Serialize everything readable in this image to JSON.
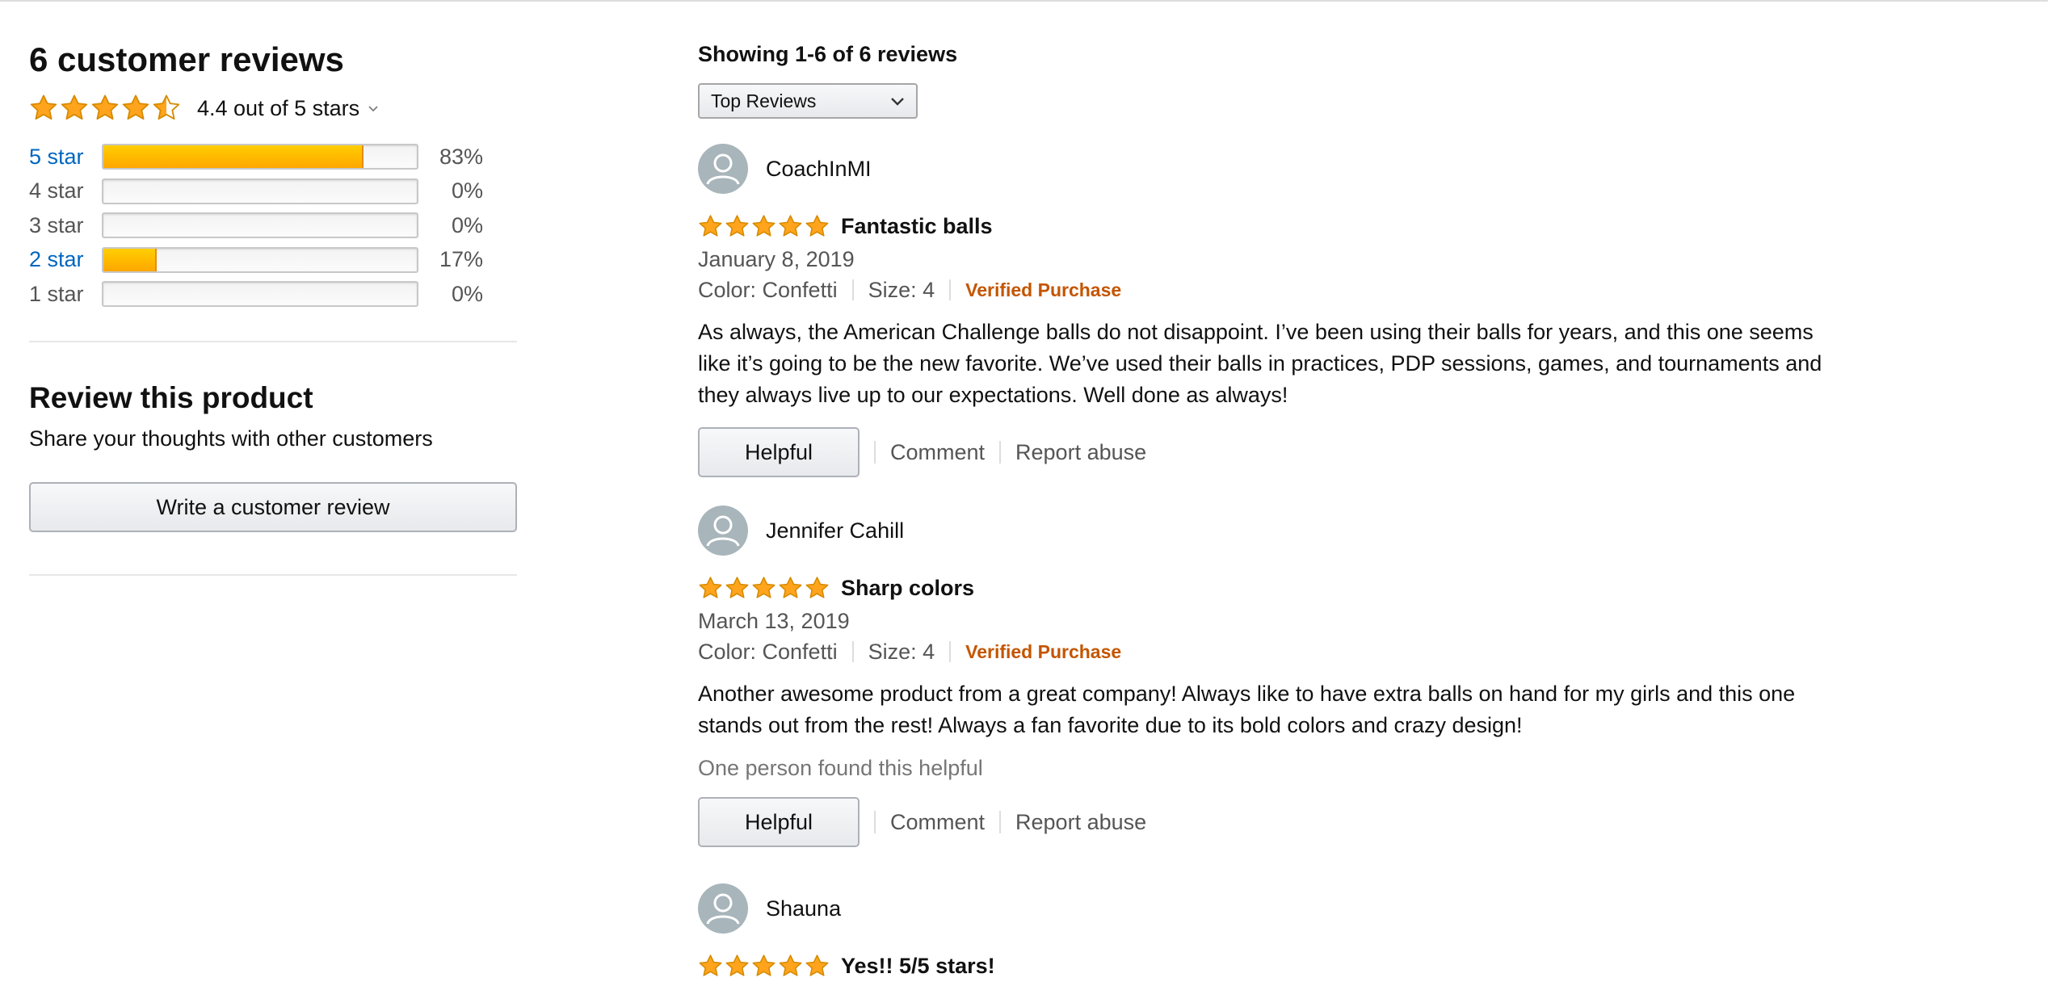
{
  "summary": {
    "heading": "6 customer reviews",
    "average_text": "4.4 out of 5 stars",
    "average_rating": 4.4,
    "histogram": [
      {
        "label": "5 star",
        "percent_text": "83%",
        "percent": 83,
        "link": true
      },
      {
        "label": "4 star",
        "percent_text": "0%",
        "percent": 0,
        "link": false
      },
      {
        "label": "3 star",
        "percent_text": "0%",
        "percent": 0,
        "link": false
      },
      {
        "label": "2 star",
        "percent_text": "17%",
        "percent": 17,
        "link": true
      },
      {
        "label": "1 star",
        "percent_text": "0%",
        "percent": 0,
        "link": false
      }
    ]
  },
  "review_cta": {
    "heading": "Review this product",
    "subtext": "Share your thoughts with other customers",
    "button_label": "Write a customer review"
  },
  "list": {
    "showing_text": "Showing 1-6 of 6 reviews",
    "sort_value": "Top Reviews"
  },
  "reviews": [
    {
      "author": "CoachInMI",
      "rating": 5,
      "title": "Fantastic balls",
      "date": "January 8, 2019",
      "color": "Color: Confetti",
      "size": "Size: 4",
      "verified": "Verified Purchase",
      "body": "As always, the American Challenge balls do not disappoint. I’ve been using their balls for years, and this one seems like it’s going to be the new favorite. We’ve used their balls in practices, PDP sessions, games, and tournaments and they always live up to our expectations. Well done as always!",
      "helpful_count": "",
      "helpful_label": "Helpful",
      "comment_label": "Comment",
      "report_label": "Report abuse"
    },
    {
      "author": "Jennifer Cahill",
      "rating": 5,
      "title": "Sharp colors",
      "date": "March 13, 2019",
      "color": "Color: Confetti",
      "size": "Size: 4",
      "verified": "Verified Purchase",
      "body": "Another awesome product from a great company! Always like to have extra balls on hand for my girls and this one stands out from the rest! Always a fan favorite due to its bold colors and crazy design!",
      "helpful_count": "One person found this helpful",
      "helpful_label": "Helpful",
      "comment_label": "Comment",
      "report_label": "Report abuse"
    },
    {
      "author": "Shauna",
      "rating": 5,
      "title": "Yes!! 5/5 stars!"
    }
  ],
  "colors": {
    "star_fill": "#ffa41c",
    "link": "#0066c0",
    "verified": "#c45500",
    "bar_fill": "#ffa700"
  }
}
